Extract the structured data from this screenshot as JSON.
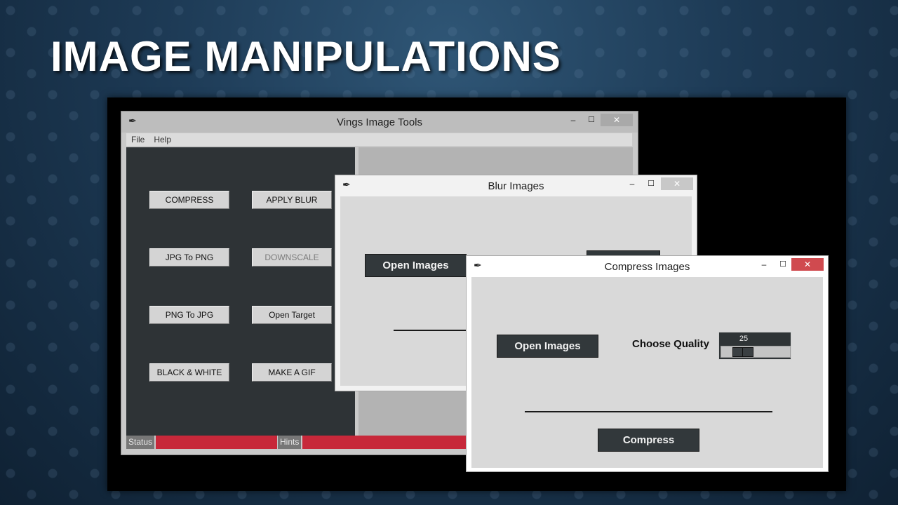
{
  "slide": {
    "title": "IMAGE MANIPULATIONS"
  },
  "main_window": {
    "title": "Vings Image Tools",
    "menu": [
      "File",
      "Help"
    ],
    "buttons": {
      "compress": "COMPRESS",
      "apply_blur": "APPLY BLUR",
      "jpg_to_png": "JPG To PNG",
      "downscale": "DOWNSCALE",
      "png_to_jpg": "PNG To JPG",
      "open_target": "Open Target",
      "black_white": "BLACK & WHITE",
      "make_gif": "MAKE A GIF"
    },
    "status_label": "Status",
    "hints_label": "Hints"
  },
  "blur_window": {
    "title": "Blur Images",
    "open_images_label": "Open Images"
  },
  "compress_window": {
    "title": "Compress Images",
    "open_images_label": "Open Images",
    "quality_label": "Choose Quality",
    "quality_value": "25",
    "compress_label": "Compress"
  },
  "window_controls": {
    "minimize": "‒",
    "maximize": "☐",
    "close": "✕"
  },
  "colors": {
    "status_bar": "#c7283a",
    "panel_dark": "#2e3336",
    "close_active": "#d04a4f"
  },
  "icons": [
    "feather-icon"
  ]
}
